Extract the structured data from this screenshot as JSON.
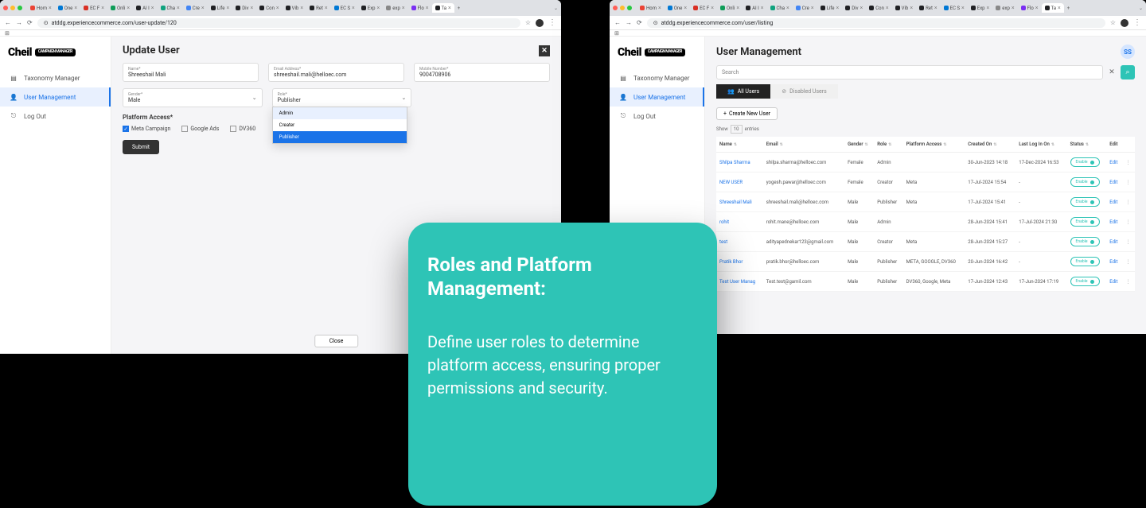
{
  "browserTabs": [
    {
      "label": "Hom",
      "color": "#ea4335"
    },
    {
      "label": "One",
      "color": "#0078d4"
    },
    {
      "label": "EC F",
      "color": "#d93025"
    },
    {
      "label": "Onli",
      "color": "#0f9d58"
    },
    {
      "label": "AI I",
      "color": "#202124"
    },
    {
      "label": "Cha",
      "color": "#10a37f"
    },
    {
      "label": "Cre",
      "color": "#4285f4"
    },
    {
      "label": "Life",
      "color": "#202124"
    },
    {
      "label": "Div",
      "color": "#202124"
    },
    {
      "label": "Con",
      "color": "#202124"
    },
    {
      "label": "Vib",
      "color": "#202124"
    },
    {
      "label": "Ret",
      "color": "#202124"
    },
    {
      "label": "EC S",
      "color": "#0078d4"
    },
    {
      "label": "Exp",
      "color": "#202124"
    },
    {
      "label": "exp",
      "color": "#888"
    },
    {
      "label": "Flo",
      "color": "#7b2ff2"
    },
    {
      "label": "Ta",
      "color": "#202124",
      "active": true
    }
  ],
  "left": {
    "url": "atddg.experiencecommerce.com/user-update/120",
    "brand": "Cheil",
    "brandSub": "CAMPAIGN MANAGER",
    "nav": {
      "taxonomy": "Taxonomy Manager",
      "users": "User Management",
      "logout": "Log Out"
    },
    "title": "Update User",
    "fields": {
      "nameLabel": "Name*",
      "nameVal": "Shreeshail Mali",
      "emailLabel": "Email Address*",
      "emailVal": "shreeshail.mali@helloec.com",
      "mobileLabel": "Mobile Number*",
      "mobileVal": "9004708906",
      "genderLabel": "Gender*",
      "genderVal": "Male",
      "roleLabel": "Role*",
      "roleVal": "Publisher"
    },
    "roleOptions": {
      "admin": "Admin",
      "creator": "Creater",
      "publisher": "Publisher"
    },
    "platformLabel": "Platform Access*",
    "platforms": {
      "meta": "Meta Campaign",
      "google": "Google Ads",
      "dv": "DV360"
    },
    "submit": "Submit",
    "close": "Close"
  },
  "right": {
    "url": "atddg.experiencecommerce.com/user/listing",
    "avatar": "SS",
    "title": "User Management",
    "searchPlaceholder": "Search",
    "tabs": {
      "all": "All Users",
      "disabled": "Disabled Users"
    },
    "create": "Create New User",
    "show": {
      "pre": "Show",
      "val": "10",
      "post": "entries"
    },
    "cols": {
      "name": "Name",
      "email": "Email",
      "gender": "Gender",
      "role": "Role",
      "platform": "Platform Access",
      "created": "Created On",
      "lastlog": "Last Log In On",
      "status": "Status",
      "edit": "Edit"
    },
    "rows": [
      {
        "name": "Shilpa Sharma",
        "email": "shilpa.sharma@helloec.com",
        "gender": "Female",
        "role": "Admin",
        "platform": "",
        "created": "30-Jun-2023 14:18",
        "last": "17-Dec-2024 16:53"
      },
      {
        "name": "NEW USER",
        "email": "yogesh.pawar@helloec.com",
        "gender": "Female",
        "role": "Creator",
        "platform": "Meta",
        "created": "17-Jul-2024 15:54",
        "last": "-"
      },
      {
        "name": "Shreeshail Mali",
        "email": "shreeshail.mali@helloec.com",
        "gender": "Male",
        "role": "Publisher",
        "platform": "Meta",
        "created": "17-Jul-2024 15:41",
        "last": "-"
      },
      {
        "name": "rohit",
        "email": "rohit.mane@helloec.com",
        "gender": "Male",
        "role": "Admin",
        "platform": "",
        "created": "28-Jun-2024 15:41",
        "last": "17-Jul-2024 21:30"
      },
      {
        "name": "test",
        "email": "adityapednekar123@gmail.com",
        "gender": "Male",
        "role": "Creator",
        "platform": "Meta",
        "created": "28-Jun-2024 15:27",
        "last": "-"
      },
      {
        "name": "Pratik Bhor",
        "email": "pratik.bhor@helloec.com",
        "gender": "Male",
        "role": "Publisher",
        "platform": "META, GOOGLE, DV360",
        "created": "20-Jun-2024 16:42",
        "last": "-"
      },
      {
        "name": "Test User Manag",
        "email": "Test.test@gamil.com",
        "gender": "Male",
        "role": "Publisher",
        "platform": "DV360, Google, Meta",
        "created": "17-Jun-2024 12:43",
        "last": "17-Jun-2024 17:19"
      }
    ],
    "enable": "Enable",
    "editLabel": "Edit"
  },
  "callout": {
    "title": "Roles and Platform Management:",
    "body": "Define user roles to determine platform access, ensuring proper permissions and security."
  }
}
